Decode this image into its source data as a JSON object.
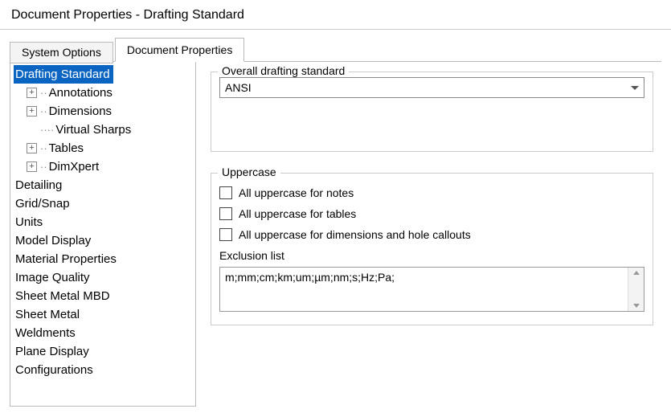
{
  "window": {
    "title": "Document Properties - Drafting Standard"
  },
  "tabs": {
    "system_options": "System Options",
    "document_properties": "Document Properties"
  },
  "tree": {
    "drafting_standard": "Drafting Standard",
    "annotations": "Annotations",
    "dimensions": "Dimensions",
    "virtual_sharps": "Virtual Sharps",
    "tables": "Tables",
    "dimxpert": "DimXpert",
    "detailing": "Detailing",
    "grid_snap": "Grid/Snap",
    "units": "Units",
    "model_display": "Model Display",
    "material_properties": "Material Properties",
    "image_quality": "Image Quality",
    "sheet_metal_mbd": "Sheet Metal MBD",
    "sheet_metal": "Sheet Metal",
    "weldments": "Weldments",
    "plane_display": "Plane Display",
    "configurations": "Configurations"
  },
  "overall": {
    "legend": "Overall drafting standard",
    "value": "ANSI"
  },
  "uppercase": {
    "legend": "Uppercase",
    "notes": "All uppercase for notes",
    "tables": "All uppercase for tables",
    "dims": "All uppercase for dimensions and hole callouts",
    "exclusion_label": "Exclusion list",
    "exclusion_value": "m;mm;cm;km;um;µm;nm;s;Hz;Pa;"
  }
}
